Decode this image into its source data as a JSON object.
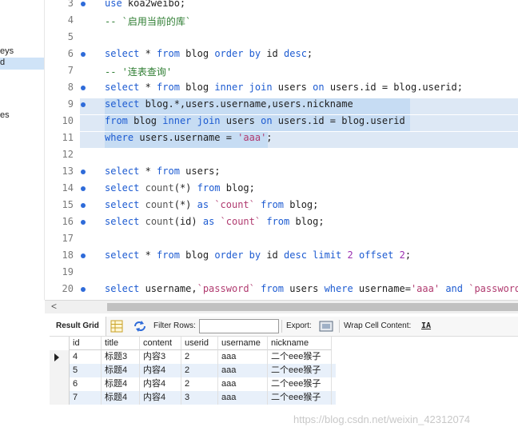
{
  "sidebar": {
    "items": [
      "eys",
      "d",
      "es"
    ]
  },
  "editor": {
    "lines": [
      {
        "n": "3",
        "dot": true,
        "tokens": [
          [
            "kw",
            "use"
          ],
          [
            "plain",
            " koa2weibo;"
          ]
        ]
      },
      {
        "n": "4",
        "dot": false,
        "tokens": [
          [
            "cm",
            "-- `启用当前的库`"
          ]
        ]
      },
      {
        "n": "5",
        "dot": false,
        "tokens": []
      },
      {
        "n": "6",
        "dot": true,
        "tokens": [
          [
            "kw",
            "select"
          ],
          [
            "plain",
            " * "
          ],
          [
            "kw",
            "from"
          ],
          [
            "plain",
            " blog "
          ],
          [
            "kw",
            "order by"
          ],
          [
            "plain",
            " id "
          ],
          [
            "kw",
            "desc"
          ],
          [
            "plain",
            ";"
          ]
        ]
      },
      {
        "n": "7",
        "dot": false,
        "tokens": [
          [
            "cm",
            "-- '连表查询'"
          ]
        ]
      },
      {
        "n": "8",
        "dot": true,
        "tokens": [
          [
            "kw",
            "select"
          ],
          [
            "plain",
            " * "
          ],
          [
            "kw",
            "from"
          ],
          [
            "plain",
            " blog "
          ],
          [
            "kw",
            "inner join"
          ],
          [
            "plain",
            " users "
          ],
          [
            "kw",
            "on"
          ],
          [
            "plain",
            " users.id = blog.userid;"
          ]
        ]
      },
      {
        "n": "9",
        "dot": true,
        "tokens": [
          [
            "kw",
            "select"
          ],
          [
            "plain",
            " blog.*,users.username,users.nickname"
          ]
        ]
      },
      {
        "n": "10",
        "dot": false,
        "tokens": [
          [
            "kw",
            "from"
          ],
          [
            "plain",
            " blog "
          ],
          [
            "kw",
            "inner join"
          ],
          [
            "plain",
            " users "
          ],
          [
            "kw",
            "on"
          ],
          [
            "plain",
            " users.id = blog.userid"
          ]
        ]
      },
      {
        "n": "11",
        "dot": false,
        "tokens": [
          [
            "kw",
            "where"
          ],
          [
            "plain",
            " users.username = "
          ],
          [
            "str",
            "'aaa'"
          ],
          [
            "plain",
            ";"
          ]
        ]
      },
      {
        "n": "12",
        "dot": false,
        "tokens": []
      },
      {
        "n": "13",
        "dot": true,
        "tokens": [
          [
            "kw",
            "select"
          ],
          [
            "plain",
            " * "
          ],
          [
            "kw",
            "from"
          ],
          [
            "plain",
            " users;"
          ]
        ]
      },
      {
        "n": "14",
        "dot": true,
        "tokens": [
          [
            "kw",
            "select"
          ],
          [
            "plain",
            " "
          ],
          [
            "fn",
            "count"
          ],
          [
            "plain",
            "(*) "
          ],
          [
            "kw",
            "from"
          ],
          [
            "plain",
            " blog;"
          ]
        ]
      },
      {
        "n": "15",
        "dot": true,
        "tokens": [
          [
            "kw",
            "select"
          ],
          [
            "plain",
            " "
          ],
          [
            "fn",
            "count"
          ],
          [
            "plain",
            "(*) "
          ],
          [
            "kw",
            "as"
          ],
          [
            "plain",
            " "
          ],
          [
            "str",
            "`count`"
          ],
          [
            "plain",
            " "
          ],
          [
            "kw",
            "from"
          ],
          [
            "plain",
            " blog;"
          ]
        ]
      },
      {
        "n": "16",
        "dot": true,
        "tokens": [
          [
            "kw",
            "select"
          ],
          [
            "plain",
            " "
          ],
          [
            "fn",
            "count"
          ],
          [
            "plain",
            "(id) "
          ],
          [
            "kw",
            "as"
          ],
          [
            "plain",
            " "
          ],
          [
            "str",
            "`count`"
          ],
          [
            "plain",
            " "
          ],
          [
            "kw",
            "from"
          ],
          [
            "plain",
            " blog;"
          ]
        ]
      },
      {
        "n": "17",
        "dot": false,
        "tokens": []
      },
      {
        "n": "18",
        "dot": true,
        "tokens": [
          [
            "kw",
            "select"
          ],
          [
            "plain",
            " * "
          ],
          [
            "kw",
            "from"
          ],
          [
            "plain",
            " blog "
          ],
          [
            "kw",
            "order by"
          ],
          [
            "plain",
            " id "
          ],
          [
            "kw",
            "desc"
          ],
          [
            "plain",
            " "
          ],
          [
            "kw",
            "limit"
          ],
          [
            "plain",
            " "
          ],
          [
            "num",
            "2"
          ],
          [
            "plain",
            " "
          ],
          [
            "kw",
            "offset"
          ],
          [
            "plain",
            " "
          ],
          [
            "num",
            "2"
          ],
          [
            "plain",
            ";"
          ]
        ]
      },
      {
        "n": "19",
        "dot": false,
        "tokens": []
      },
      {
        "n": "20",
        "dot": true,
        "tokens": [
          [
            "kw",
            "select"
          ],
          [
            "plain",
            " username,"
          ],
          [
            "str",
            "`password`"
          ],
          [
            "plain",
            " "
          ],
          [
            "kw",
            "from"
          ],
          [
            "plain",
            " users "
          ],
          [
            "kw",
            "where"
          ],
          [
            "plain",
            " username="
          ],
          [
            "str",
            "'aaa'"
          ],
          [
            "plain",
            " "
          ],
          [
            "kw",
            "and"
          ],
          [
            "plain",
            " "
          ],
          [
            "str",
            "`password`"
          ],
          [
            "plain",
            "="
          ]
        ]
      }
    ]
  },
  "toolbar": {
    "result_grid": "Result Grid",
    "filter_rows": "Filter Rows:",
    "filter_value": "",
    "export": "Export:",
    "wrap": "Wrap Cell Content:",
    "wrap_icon": "IA"
  },
  "grid": {
    "columns": [
      "id",
      "title",
      "content",
      "userid",
      "username",
      "nickname"
    ],
    "rows": [
      [
        "4",
        "标题3",
        "内容3",
        "2",
        "aaa",
        "二个eee猴子"
      ],
      [
        "5",
        "标题4",
        "内容4",
        "2",
        "aaa",
        "二个eee猴子"
      ],
      [
        "6",
        "标题4",
        "内容4",
        "2",
        "aaa",
        "二个eee猴子"
      ],
      [
        "7",
        "标题4",
        "内容4",
        "3",
        "aaa",
        "二个eee猴子"
      ]
    ]
  },
  "watermark": "https://blog.csdn.net/weixin_42312074",
  "colors": {
    "keyword": "#1d5bd1",
    "string": "#b03a6f",
    "selection": "#c6dcf3",
    "dot": "#2e6bd9"
  }
}
